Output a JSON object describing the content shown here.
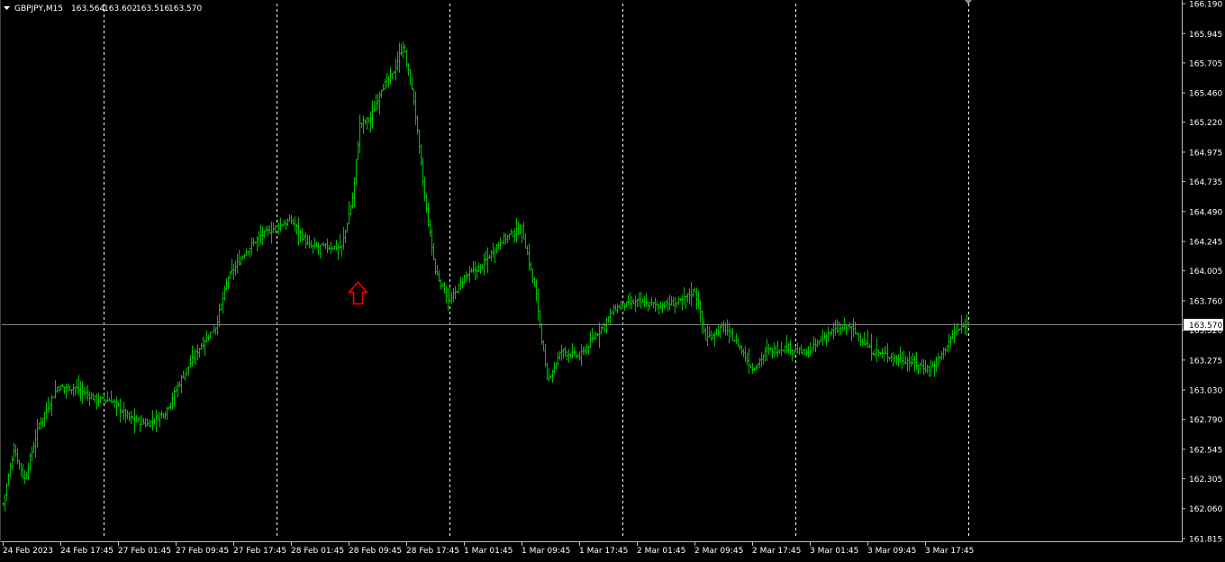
{
  "header": {
    "symbol": "GBPJPY,M15",
    "open": "163.564",
    "high": "163.602",
    "low": "163.516",
    "close": "163.570"
  },
  "current_price_label": "163.570",
  "colors": {
    "background": "#000000",
    "bars": "#00c000",
    "grid": "#ffffff",
    "axis": "#c0c0c0",
    "arrow": "#ff0000",
    "price_label_bg": "#ffffff"
  },
  "chart_data": {
    "type": "ohlc_bar",
    "symbol": "GBPJPY",
    "timeframe": "M15",
    "y_ticks": [
      "166.190",
      "165.945",
      "165.705",
      "165.460",
      "165.220",
      "164.975",
      "164.735",
      "164.490",
      "164.245",
      "164.005",
      "163.760",
      "163.520",
      "163.275",
      "163.030",
      "162.790",
      "162.545",
      "162.305",
      "162.060",
      "161.815"
    ],
    "ylim": [
      161.815,
      166.19
    ],
    "x_ticks": [
      "24 Feb 2023",
      "24 Feb 17:45",
      "27 Feb 01:45",
      "27 Feb 09:45",
      "27 Feb 17:45",
      "28 Feb 01:45",
      "28 Feb 09:45",
      "28 Feb 17:45",
      "1 Mar 01:45",
      "1 Mar 09:45",
      "1 Mar 17:45",
      "2 Mar 01:45",
      "2 Mar 09:45",
      "2 Mar 17:45",
      "3 Mar 01:45",
      "3 Mar 09:45",
      "3 Mar 17:45"
    ],
    "x_tick_index": [
      0,
      32,
      64,
      96,
      128,
      160,
      192,
      224,
      256,
      288,
      320,
      352,
      384,
      416,
      448,
      480,
      512
    ],
    "vertical_grid_index": [
      56,
      152,
      248,
      344,
      440,
      536
    ],
    "grid": "vertical dashed",
    "current_price": 163.57,
    "close_path": [
      {
        "bar": 0,
        "price": 162.1
      },
      {
        "bar": 6,
        "price": 162.55
      },
      {
        "bar": 12,
        "price": 162.3
      },
      {
        "bar": 20,
        "price": 162.75
      },
      {
        "bar": 30,
        "price": 163.05
      },
      {
        "bar": 40,
        "price": 163.05
      },
      {
        "bar": 52,
        "price": 162.95
      },
      {
        "bar": 60,
        "price": 162.95
      },
      {
        "bar": 70,
        "price": 162.8
      },
      {
        "bar": 80,
        "price": 162.75
      },
      {
        "bar": 90,
        "price": 162.85
      },
      {
        "bar": 100,
        "price": 163.15
      },
      {
        "bar": 110,
        "price": 163.4
      },
      {
        "bar": 118,
        "price": 163.55
      },
      {
        "bar": 125,
        "price": 163.95
      },
      {
        "bar": 134,
        "price": 164.15
      },
      {
        "bar": 142,
        "price": 164.28
      },
      {
        "bar": 150,
        "price": 164.35
      },
      {
        "bar": 160,
        "price": 164.42
      },
      {
        "bar": 170,
        "price": 164.2
      },
      {
        "bar": 180,
        "price": 164.2
      },
      {
        "bar": 188,
        "price": 164.2
      },
      {
        "bar": 194,
        "price": 164.6
      },
      {
        "bar": 198,
        "price": 165.2
      },
      {
        "bar": 204,
        "price": 165.25
      },
      {
        "bar": 210,
        "price": 165.5
      },
      {
        "bar": 216,
        "price": 165.6
      },
      {
        "bar": 222,
        "price": 165.85
      },
      {
        "bar": 228,
        "price": 165.4
      },
      {
        "bar": 234,
        "price": 164.6
      },
      {
        "bar": 240,
        "price": 164.0
      },
      {
        "bar": 248,
        "price": 163.75
      },
      {
        "bar": 256,
        "price": 163.95
      },
      {
        "bar": 266,
        "price": 164.05
      },
      {
        "bar": 276,
        "price": 164.25
      },
      {
        "bar": 288,
        "price": 164.35
      },
      {
        "bar": 296,
        "price": 163.8
      },
      {
        "bar": 302,
        "price": 163.1
      },
      {
        "bar": 310,
        "price": 163.35
      },
      {
        "bar": 320,
        "price": 163.3
      },
      {
        "bar": 330,
        "price": 163.5
      },
      {
        "bar": 340,
        "price": 163.7
      },
      {
        "bar": 352,
        "price": 163.75
      },
      {
        "bar": 364,
        "price": 163.72
      },
      {
        "bar": 376,
        "price": 163.75
      },
      {
        "bar": 384,
        "price": 163.85
      },
      {
        "bar": 390,
        "price": 163.45
      },
      {
        "bar": 400,
        "price": 163.55
      },
      {
        "bar": 408,
        "price": 163.4
      },
      {
        "bar": 416,
        "price": 163.2
      },
      {
        "bar": 424,
        "price": 163.35
      },
      {
        "bar": 436,
        "price": 163.38
      },
      {
        "bar": 446,
        "price": 163.32
      },
      {
        "bar": 458,
        "price": 163.5
      },
      {
        "bar": 470,
        "price": 163.55
      },
      {
        "bar": 482,
        "price": 163.35
      },
      {
        "bar": 494,
        "price": 163.3
      },
      {
        "bar": 506,
        "price": 163.25
      },
      {
        "bar": 514,
        "price": 163.2
      },
      {
        "bar": 520,
        "price": 163.3
      },
      {
        "bar": 528,
        "price": 163.5
      },
      {
        "bar": 536,
        "price": 163.58
      }
    ],
    "annotation": {
      "type": "arrow-up",
      "bar": 197,
      "price": 164.0
    }
  }
}
